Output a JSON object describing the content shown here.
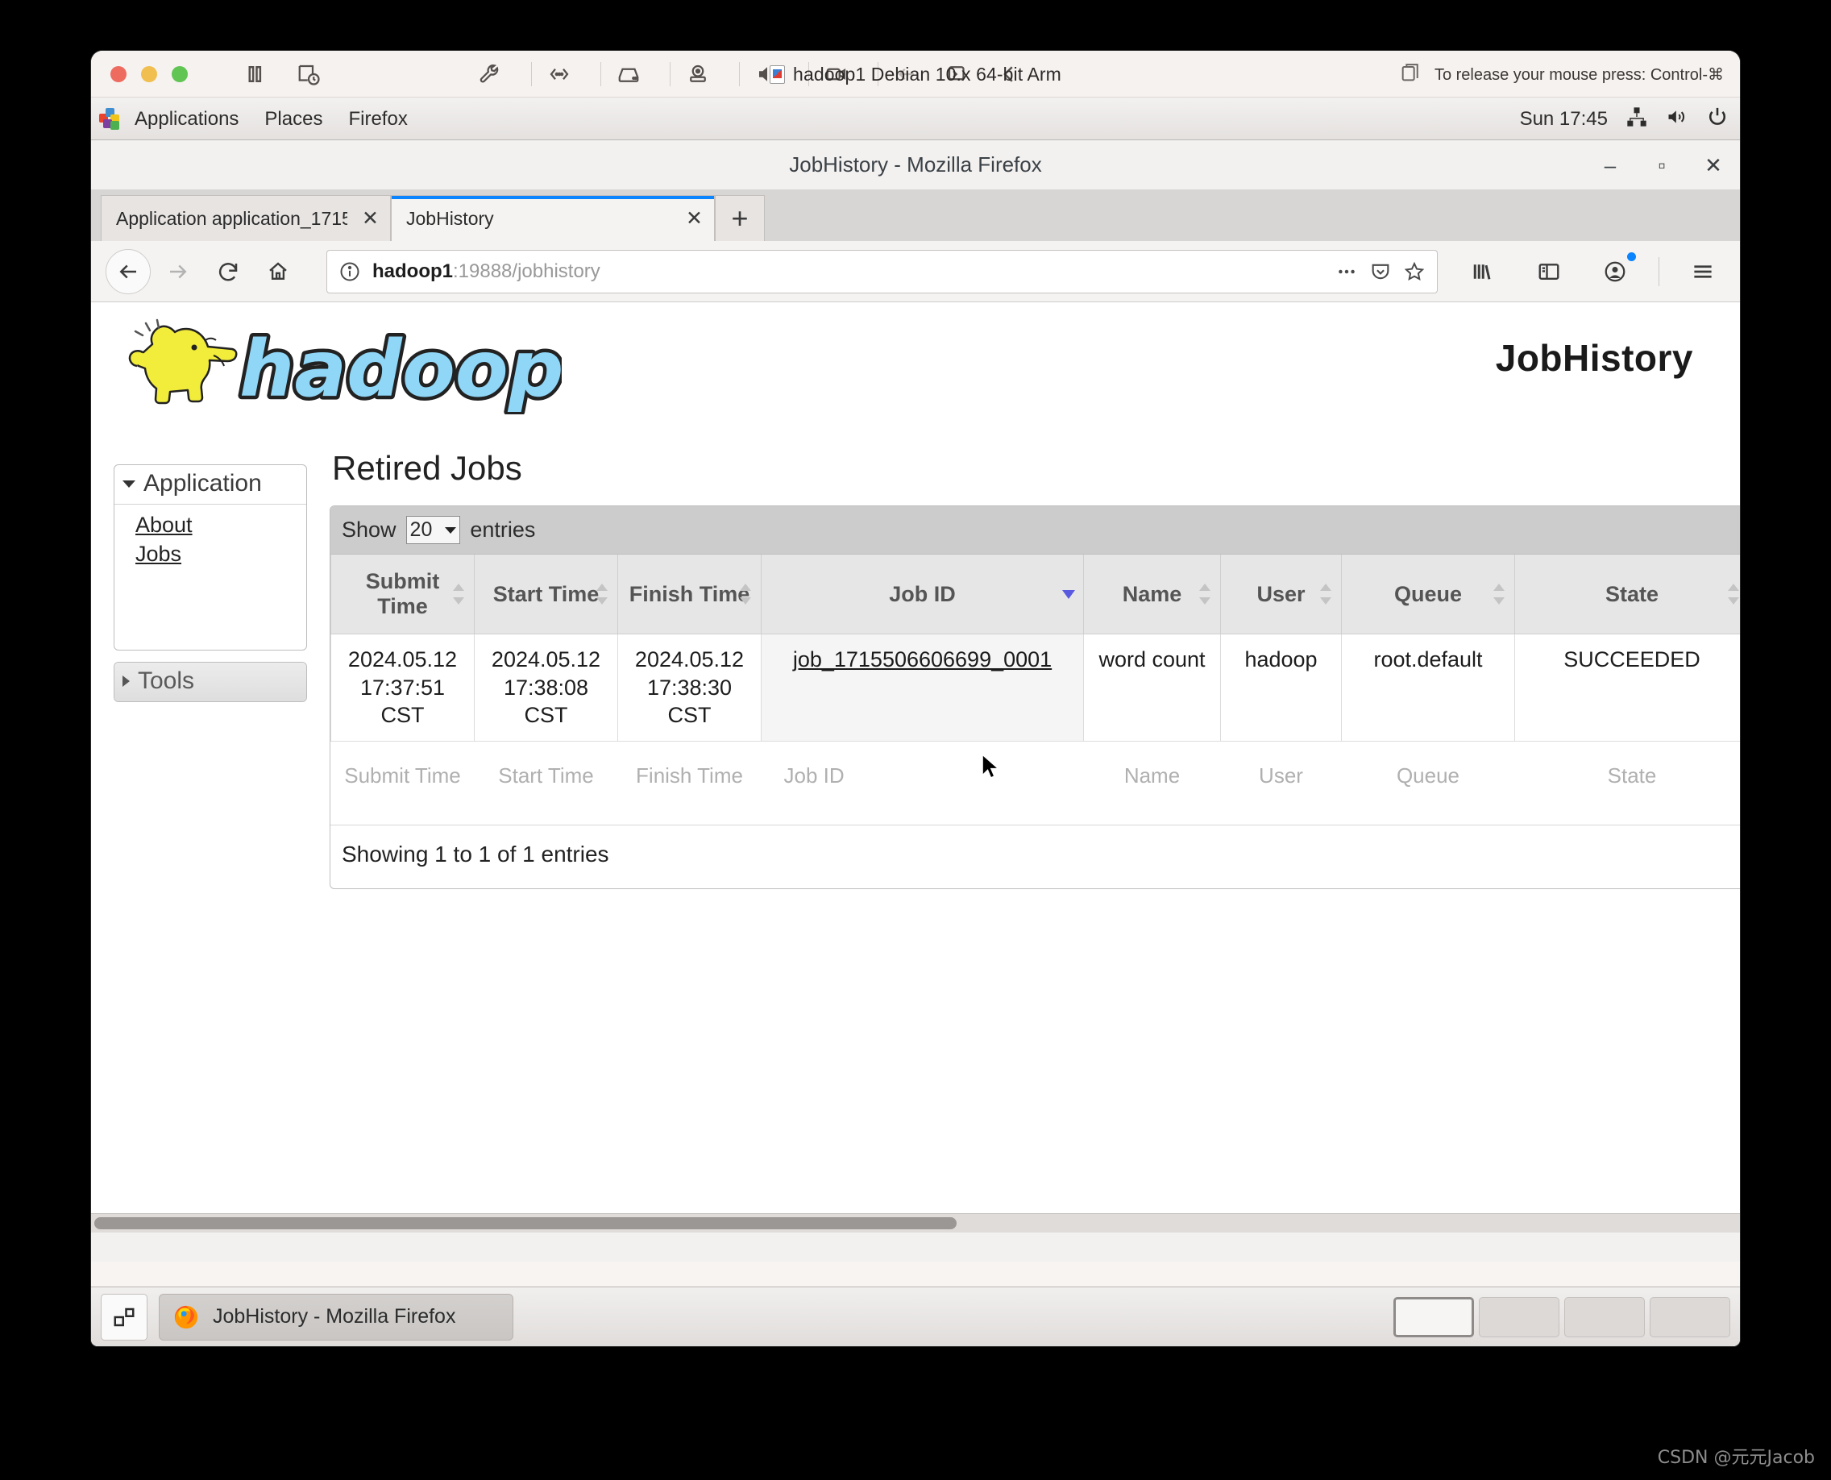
{
  "vm": {
    "title": "hadoop1 Debian 10.x 64-bit Arm",
    "release_hint": "To release your mouse press: Control-⌘",
    "toolbar_icons": [
      "pause-icon",
      "snapshot-icon",
      "wrench-icon",
      "network-icon",
      "disk-icon",
      "camera-icon",
      "speaker-icon",
      "video-icon",
      "share-icon",
      "sync-icon",
      "back-icon"
    ]
  },
  "gnome": {
    "menus": [
      "Applications",
      "Places",
      "Firefox"
    ],
    "clock": "Sun 17:45",
    "tray_icons": [
      "network-icon",
      "volume-icon",
      "power-icon"
    ]
  },
  "firefox": {
    "window_title": "JobHistory - Mozilla Firefox",
    "window_buttons": {
      "minimize": "–",
      "maximize": "▫",
      "close": "✕"
    },
    "tabs": [
      {
        "label": "Application application_1715…",
        "active": false,
        "close": "✕"
      },
      {
        "label": "JobHistory",
        "active": true,
        "close": "✕"
      }
    ],
    "new_tab_label": "+",
    "nav": {
      "back": "←",
      "forward": "→",
      "reload": "↻",
      "home": "⌂"
    },
    "url": {
      "host": "hadoop1",
      "rest": ":19888/jobhistory",
      "full": "hadoop1:19888/jobhistory"
    },
    "url_icons": [
      "info-icon",
      "page-actions-icon",
      "pocket-icon",
      "bookmark-star-icon"
    ],
    "toolbar_icons": [
      "library-icon",
      "sidebar-icon",
      "account-icon",
      "menu-icon"
    ]
  },
  "page": {
    "logo_alt": "hadoop",
    "heading": "JobHistory",
    "sidebar": {
      "application": {
        "label": "Application",
        "expanded": true,
        "links": [
          "About",
          "Jobs"
        ]
      },
      "tools": {
        "label": "Tools",
        "expanded": false
      }
    },
    "main": {
      "title": "Retired Jobs",
      "show_prefix": "Show",
      "page_length": "20",
      "show_suffix": "entries",
      "columns": [
        {
          "label": "Submit Time",
          "sort": "both"
        },
        {
          "label": "Start Time",
          "sort": "both"
        },
        {
          "label": "Finish Time",
          "sort": "both"
        },
        {
          "label": "Job ID",
          "sort": "desc"
        },
        {
          "label": "Name",
          "sort": "both"
        },
        {
          "label": "User",
          "sort": "both"
        },
        {
          "label": "Queue",
          "sort": "both"
        },
        {
          "label": "State",
          "sort": "both"
        }
      ],
      "rows": [
        {
          "submit_time": "2024.05.12 17:37:51 CST",
          "start_time": "2024.05.12 17:38:08 CST",
          "finish_time": "2024.05.12 17:38:30 CST",
          "job_id": "job_1715506606699_0001",
          "name": "word count",
          "user": "hadoop",
          "queue": "root.default",
          "state": "SUCCEEDED"
        }
      ],
      "filter_placeholders": [
        "Submit Time",
        "Start Time",
        "Finish Time",
        "Job ID",
        "Name",
        "User",
        "Queue",
        "State"
      ],
      "showing_info": "Showing 1 to 1 of 1 entries"
    }
  },
  "taskbar": {
    "show_desktop_icon": "show-desktop-icon",
    "task_label": "JobHistory - Mozilla Firefox",
    "workspaces": [
      "1",
      "2",
      "3",
      "4"
    ],
    "active_workspace": 0
  },
  "watermark": "CSDN @元元Jacob",
  "colors": {
    "tab_accent": "#0a84ff",
    "sort_active": "#5a5ae0",
    "logo_yellow": "#f2ec3a",
    "logo_blue": "#8fd6f7"
  }
}
